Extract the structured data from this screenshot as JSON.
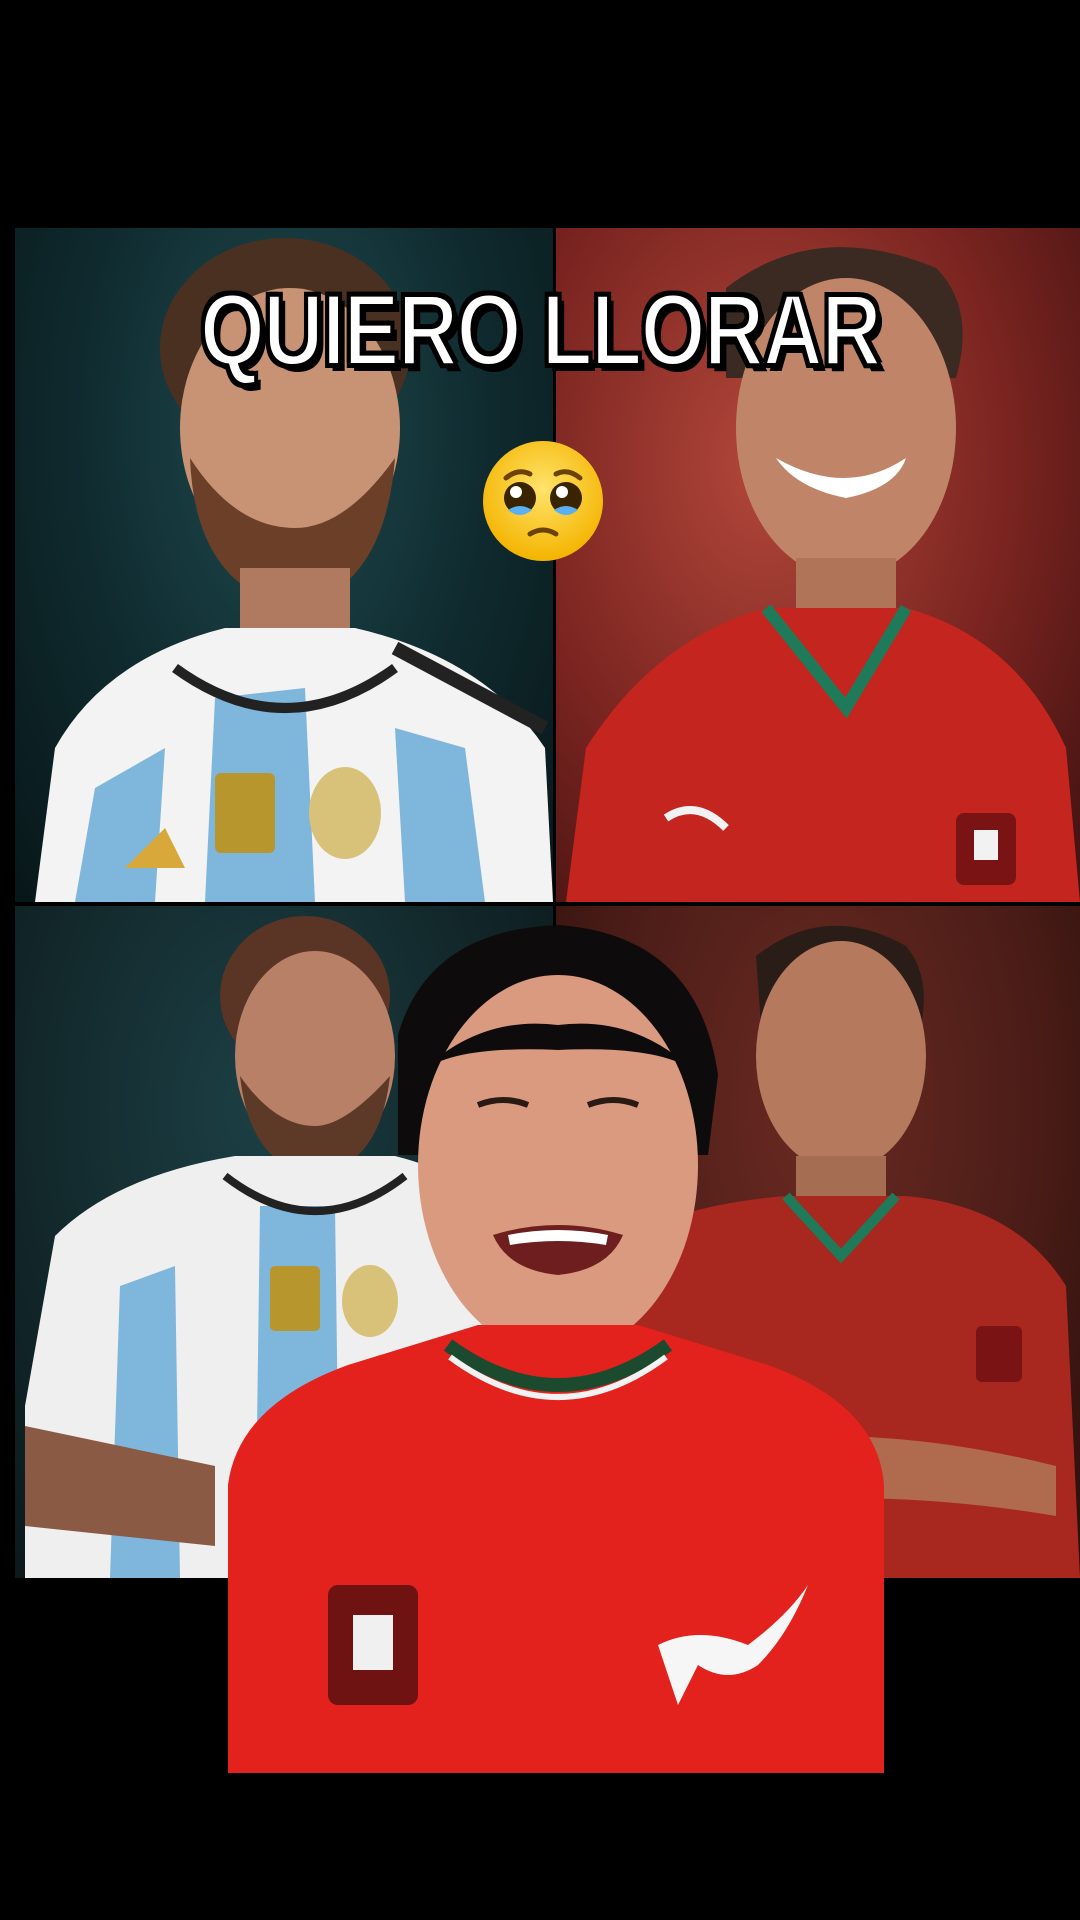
{
  "video": {
    "caption": "QUIERO LLORAR",
    "emoji": "pleading-face-emoji",
    "panels": [
      {
        "position": "top-left",
        "subject": "player-argentina-jersey"
      },
      {
        "position": "top-right",
        "subject": "player-portugal-jersey"
      },
      {
        "position": "bottom-left",
        "subject": "player-argentina-jersey"
      },
      {
        "position": "bottom-right",
        "subject": "player-portugal-jersey"
      }
    ],
    "overlay": "creator-in-red-jersey"
  },
  "colors": {
    "background": "#000000",
    "caption_text": "#ffffff",
    "caption_outline": "#000000",
    "argentina_sky": "#7fb6dc",
    "portugal_red": "#c4251f"
  }
}
